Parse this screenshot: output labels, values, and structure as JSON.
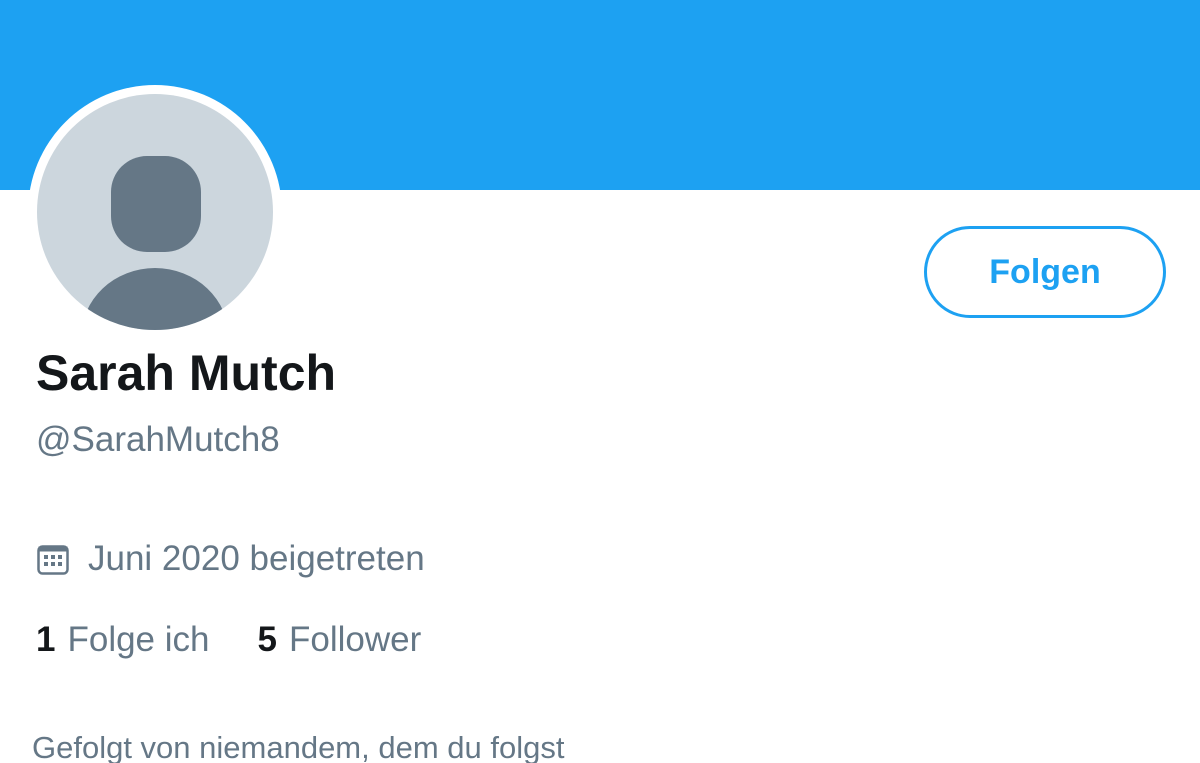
{
  "colors": {
    "banner": "#1da1f2",
    "accent": "#1da1f2",
    "text_primary": "#14171a",
    "text_secondary": "#657786",
    "avatar_bg": "#ccd6dd",
    "avatar_fg": "#657786"
  },
  "profile": {
    "display_name": "Sarah Mutch",
    "handle": "@SarahMutch8",
    "avatar_icon": "default-avatar-icon",
    "joined_icon": "calendar-icon",
    "joined_text": "Juni 2020 beigetreten",
    "follow_button_label": "Folgen"
  },
  "stats": {
    "following_count": "1",
    "following_label": "Folge ich",
    "followers_count": "5",
    "followers_label": "Follower"
  },
  "social_context": "Gefolgt von niemandem, dem du folgst"
}
